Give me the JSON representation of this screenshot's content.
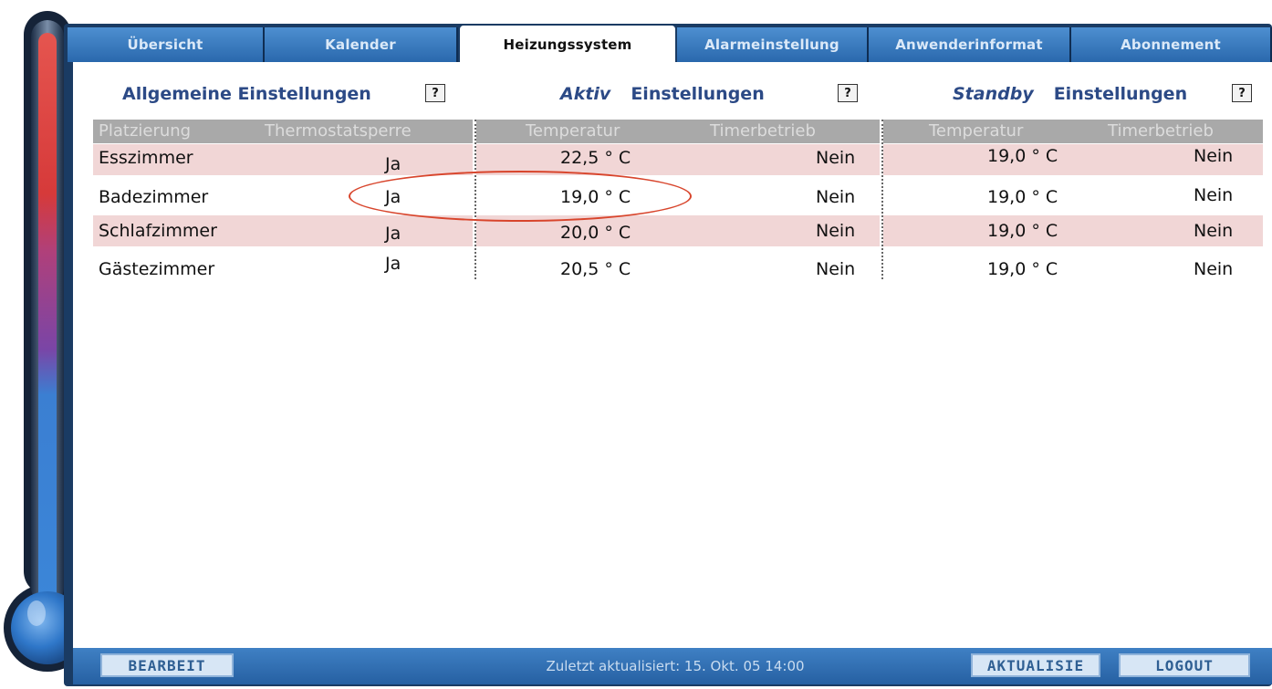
{
  "tabs": [
    {
      "label": "Übersicht"
    },
    {
      "label": "Kalender"
    },
    {
      "label": "Heizungssystem"
    },
    {
      "label": "Alarmeinstellung"
    },
    {
      "label": "Anwenderinformat"
    },
    {
      "label": "Abonnement"
    }
  ],
  "active_tab": "Heizungssystem",
  "sections": {
    "general": {
      "title": "Allgemeine Einstellungen",
      "help": "?"
    },
    "active": {
      "prefix": "Aktiv",
      "title": "Einstellungen",
      "help": "?"
    },
    "standby": {
      "prefix": "Standby",
      "title": "Einstellungen",
      "help": "?"
    }
  },
  "table": {
    "headers": {
      "placement": "Platzierung",
      "lock": "Thermostatsperre",
      "active_temp": "Temperatur",
      "active_timer": "Timerbetrieb",
      "standby_temp": "Temperatur",
      "standby_timer": "Timerbetrieb"
    },
    "rows": [
      {
        "room": "Esszimmer",
        "lock": "Ja",
        "active_temp": "22,5 ° C",
        "active_timer": "Nein",
        "standby_temp": "19,0 ° C",
        "standby_timer": "Nein"
      },
      {
        "room": "Badezimmer",
        "lock": "Ja",
        "active_temp": "19,0 ° C",
        "active_timer": "Nein",
        "standby_temp": "19,0 ° C",
        "standby_timer": "Nein"
      },
      {
        "room": "Schlafzimmer",
        "lock": "Ja",
        "active_temp": "20,0 ° C",
        "active_timer": "Nein",
        "standby_temp": "19,0 ° C",
        "standby_timer": "Nein"
      },
      {
        "room": "Gästezimmer",
        "lock": "Ja",
        "active_temp": "20,5 ° C",
        "active_timer": "Nein",
        "standby_temp": "19,0 ° C",
        "standby_timer": "Nein"
      }
    ]
  },
  "footer": {
    "edit_label": "BEARBEIT",
    "status": "Zuletzt aktualisiert: 15. Okt. 05 14:00",
    "refresh_label": "AKTUALISIE",
    "logout_label": "LOGOUT"
  },
  "colors": {
    "frame": "#1a3b63",
    "tab": "#2a68ad",
    "row_highlight": "#f1d6d6",
    "header_bg": "#a9a9a9",
    "highlight_ellipse": "#d8452c"
  }
}
